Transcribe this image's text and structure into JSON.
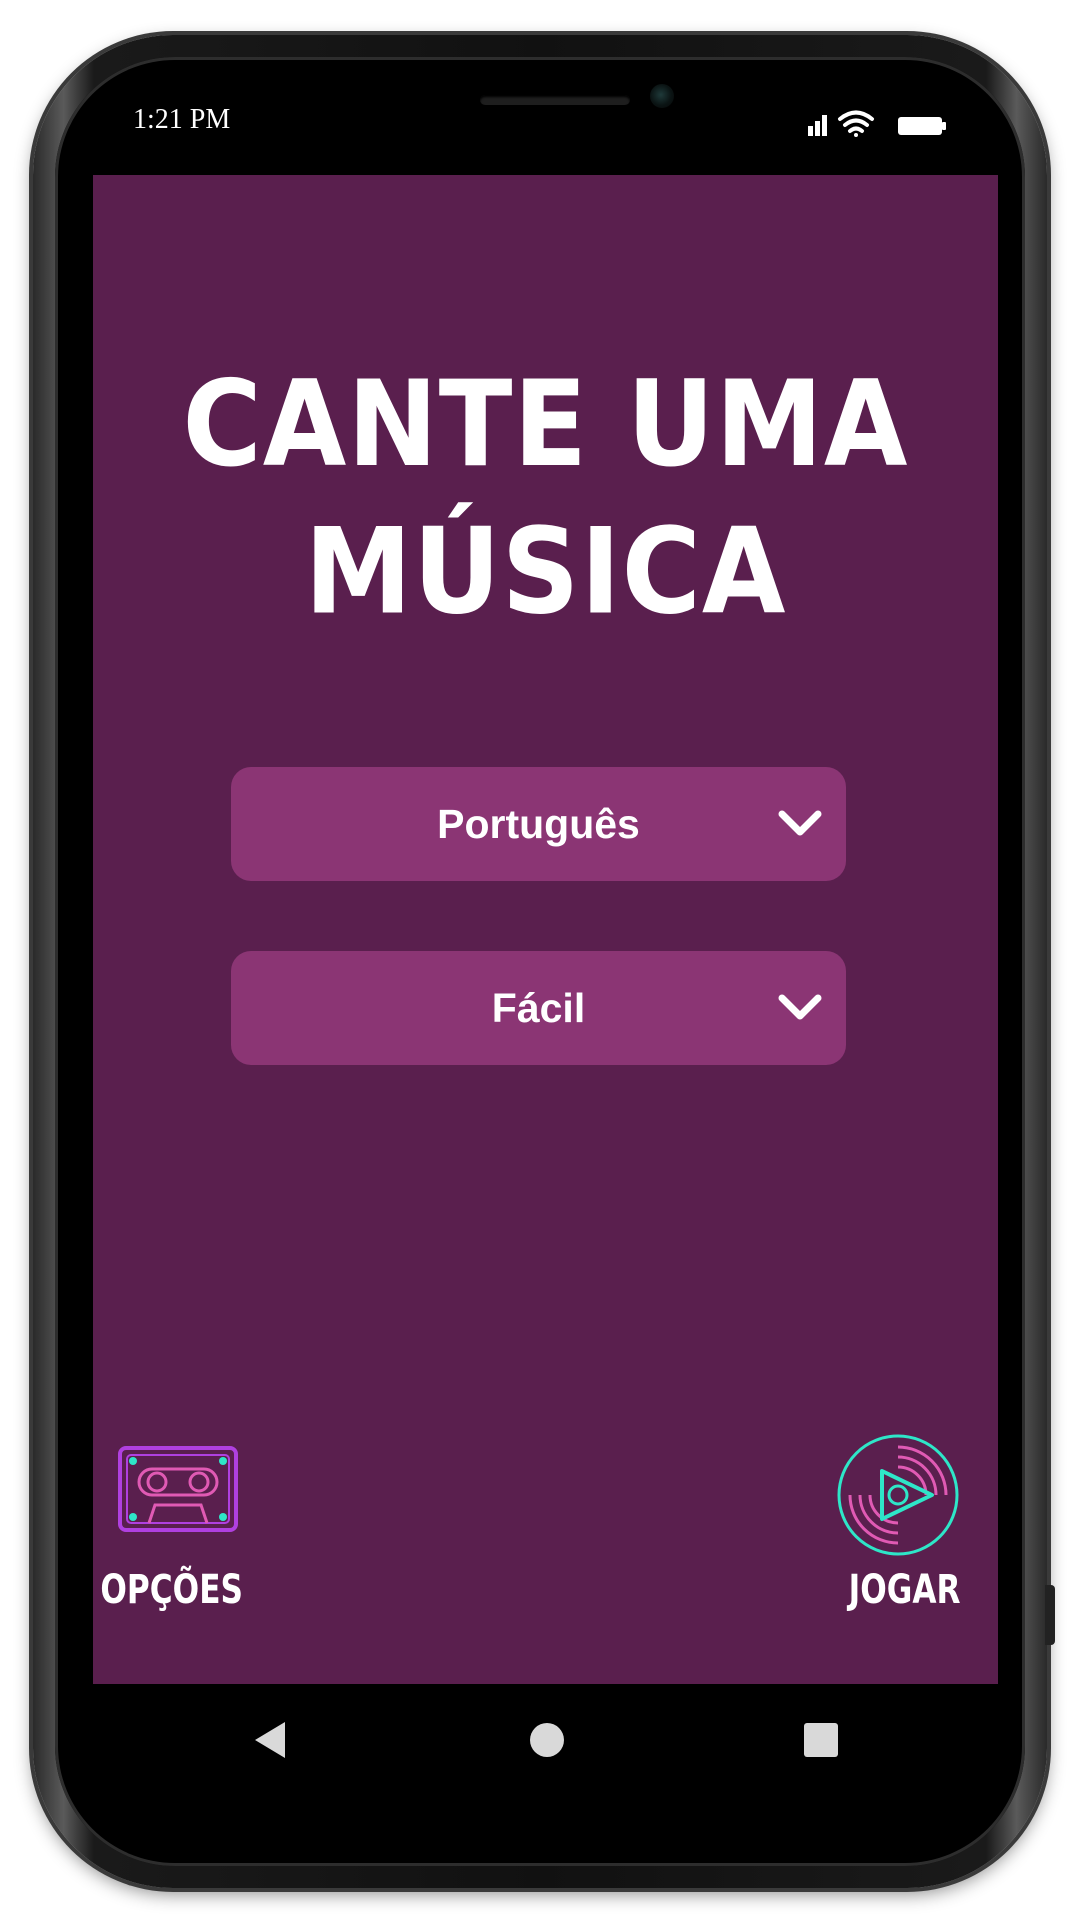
{
  "status_bar": {
    "time": "1:21 PM"
  },
  "app": {
    "title": "CANTE UMA MÚSICA",
    "title_line1": "CANTE UMA",
    "title_line2": "MÚSICA",
    "colors": {
      "background": "#5a1f4e",
      "dropdown": "#8b3574",
      "text": "#ffffff",
      "accent_teal": "#2ee6c8",
      "accent_pink": "#e05ab4",
      "accent_purple": "#b040e0"
    }
  },
  "dropdowns": {
    "language": {
      "selected": "Português",
      "icon": "chevron-down-icon"
    },
    "difficulty": {
      "selected": "Fácil",
      "icon": "chevron-down-icon"
    }
  },
  "actions": {
    "options": {
      "label": "OPÇÕES",
      "icon": "cassette-icon"
    },
    "play": {
      "label": "JOGAR",
      "icon": "vinyl-play-icon"
    }
  },
  "navigation": {
    "back_icon": "back-triangle-icon",
    "home_icon": "home-circle-icon",
    "recents_icon": "recents-square-icon"
  }
}
